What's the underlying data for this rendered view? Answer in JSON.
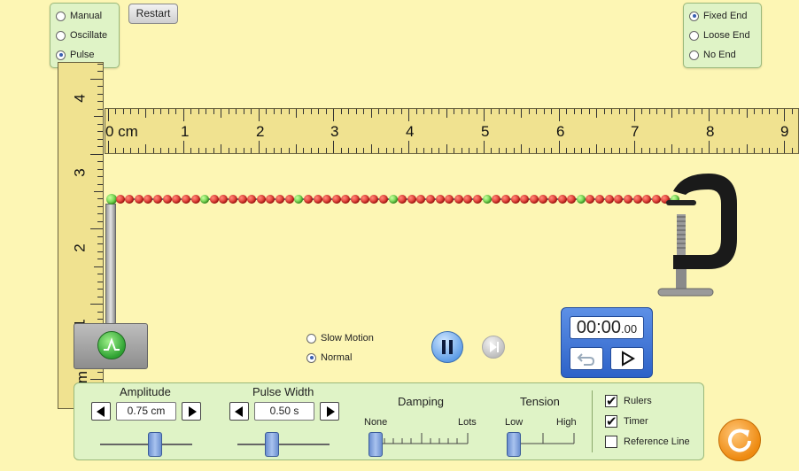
{
  "mode": {
    "options": [
      {
        "label": "Manual",
        "selected": false
      },
      {
        "label": "Oscillate",
        "selected": false
      },
      {
        "label": "Pulse",
        "selected": true
      }
    ]
  },
  "restart_label": "Restart",
  "end_type": {
    "options": [
      {
        "label": "Fixed End",
        "selected": true
      },
      {
        "label": "Loose End",
        "selected": false
      },
      {
        "label": "No End",
        "selected": false
      }
    ]
  },
  "ruler_h": {
    "unit_label": "0 cm",
    "numbers": [
      "1",
      "2",
      "3",
      "4",
      "5",
      "6",
      "7",
      "8",
      "9"
    ]
  },
  "ruler_v": {
    "numbers": [
      "4",
      "3",
      "2",
      "1"
    ],
    "edge_label": "m"
  },
  "speed": {
    "options": [
      {
        "label": "Slow Motion",
        "selected": false
      },
      {
        "label": "Normal",
        "selected": true
      }
    ]
  },
  "timer": {
    "main": "00:00",
    "fraction": ".00"
  },
  "controls": {
    "amplitude": {
      "label": "Amplitude",
      "value": "0.75 cm"
    },
    "pulse_width": {
      "label": "Pulse Width",
      "value": "0.50 s"
    },
    "damping": {
      "label": "Damping",
      "min_label": "None",
      "max_label": "Lots"
    },
    "tension": {
      "label": "Tension",
      "min_label": "Low",
      "max_label": "High"
    },
    "checkboxes": [
      {
        "label": "Rulers",
        "checked": true
      },
      {
        "label": "Timer",
        "checked": true
      },
      {
        "label": "Reference Line",
        "checked": false
      }
    ]
  },
  "colors": {
    "background": "#fdf6b4",
    "panel": "#dff3c6",
    "bead_red": "#d9201a",
    "bead_green": "#4fc42e",
    "timer_blue": "#2d62c8",
    "reset_orange": "#ee8a10"
  },
  "icons": {
    "pulse": "pulse-wave-icon",
    "pause": "pause-icon",
    "step": "step-forward-icon",
    "timer_reset": "undo-icon",
    "timer_play": "play-icon",
    "reset_all": "refresh-icon",
    "clamp": "c-clamp-icon"
  }
}
